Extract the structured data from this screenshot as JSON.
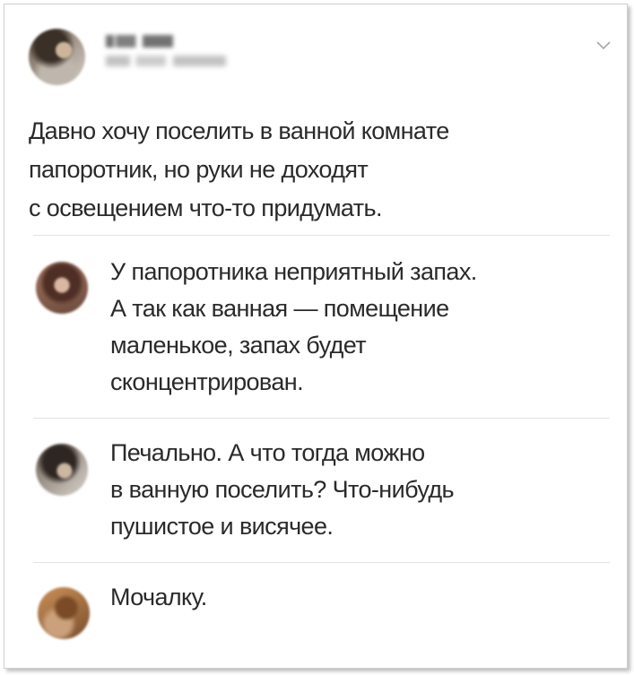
{
  "post": {
    "text": "Давно хочу поселить в ванной комнате\nпапоротник, но руки не доходят\nс освещением что-то придумать."
  },
  "replies": [
    {
      "text": "У папоротника неприятный запах.\nА так как ванная — помещение\nмаленькое, запах будет\nсконцентрирован."
    },
    {
      "text": "Печально. А что тогда можно\nв ванную поселить? Что-нибудь\nпушистое и висячее."
    },
    {
      "text": "Мочалку."
    }
  ],
  "icons": {
    "menu": "chevron-down-icon"
  }
}
